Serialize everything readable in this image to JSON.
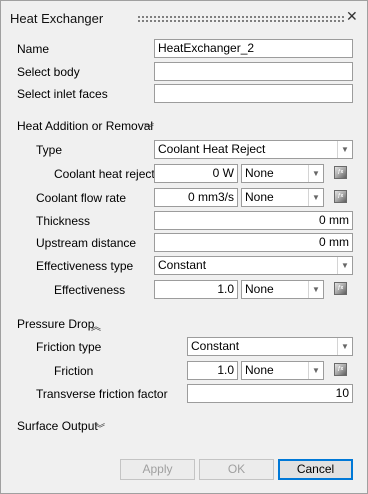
{
  "title": "Heat Exchanger",
  "fields": {
    "name_label": "Name",
    "name_value": "HeatExchanger_2",
    "select_body_label": "Select body",
    "select_body_value": "",
    "select_inlet_label": "Select inlet faces",
    "select_inlet_value": ""
  },
  "heat": {
    "section_label": "Heat Addition or Removal",
    "type_label": "Type",
    "type_value": "Coolant Heat Reject",
    "coolant_heat_label": "Coolant heat reject",
    "coolant_heat_value": "0 W",
    "coolant_heat_unit_option": "None",
    "flow_rate_label": "Coolant flow rate",
    "flow_rate_value": "0 mm3/s",
    "flow_rate_unit_option": "None",
    "thickness_label": "Thickness",
    "thickness_value": "0 mm",
    "upstream_label": "Upstream distance",
    "upstream_value": "0 mm",
    "eff_type_label": "Effectiveness type",
    "eff_type_value": "Constant",
    "eff_label": "Effectiveness",
    "eff_value": "1.0",
    "eff_unit_option": "None"
  },
  "pressure": {
    "section_label": "Pressure Drop",
    "friction_type_label": "Friction type",
    "friction_type_value": "Constant",
    "friction_label": "Friction",
    "friction_value": "1.0",
    "friction_unit_option": "None",
    "transverse_label": "Transverse friction factor",
    "transverse_value": "10"
  },
  "surface": {
    "section_label": "Surface Output"
  },
  "buttons": {
    "apply": "Apply",
    "ok": "OK",
    "cancel": "Cancel"
  },
  "icons": {
    "close": "close-icon",
    "chevron_down": "chevron-down-icon",
    "chevron_up": "chevron-up-icon",
    "arrow": "dropdown-arrow-icon",
    "picker": "function-picker-icon"
  }
}
